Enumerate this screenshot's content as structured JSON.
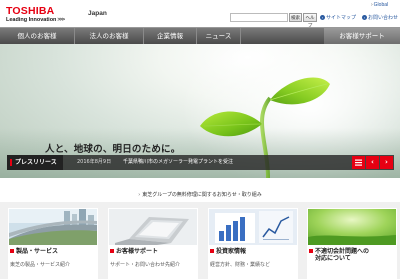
{
  "header": {
    "logo": "TOSHIBA",
    "tagline": "Leading Innovation",
    "tagline_arrows": ">>>",
    "region": "Japan",
    "global_link": "Global",
    "search_placeholder": "",
    "search_button": "検索",
    "help_button": "ヘルプ",
    "sitemap_link": "サイトマップ",
    "contact_link": "お問い合わせ"
  },
  "nav": {
    "items": [
      "個人のお客様",
      "法人のお客様",
      "企業情報",
      "ニュース"
    ],
    "support": "お客様サポート"
  },
  "hero": {
    "headline": "人と、地球の、明日のために。"
  },
  "press": {
    "label": "プレスリリース",
    "date": "2016年8月9日",
    "text": "千葉県鴨川市のメガソーラー発電プラントを受注",
    "list_icon": "list-icon",
    "prev_icon": "chevron-left-icon",
    "next_icon": "chevron-right-icon"
  },
  "notice": {
    "text": "東芝グループの無料修理に関するお知らせ・取り組み"
  },
  "cards": [
    {
      "title": "製品・サービス",
      "desc": "東芝の製品・サービス紹介"
    },
    {
      "title": "お客様サポート",
      "desc": "サポート・お問い合わせ先紹介"
    },
    {
      "title": "投資家情報",
      "desc": "経営方針、財務・業績など"
    },
    {
      "title": "不適切会計問題への",
      "title2": "対応について",
      "desc": ""
    }
  ],
  "colors": {
    "brand_red": "#e60012",
    "nav_gray": "#5a5a5a"
  }
}
